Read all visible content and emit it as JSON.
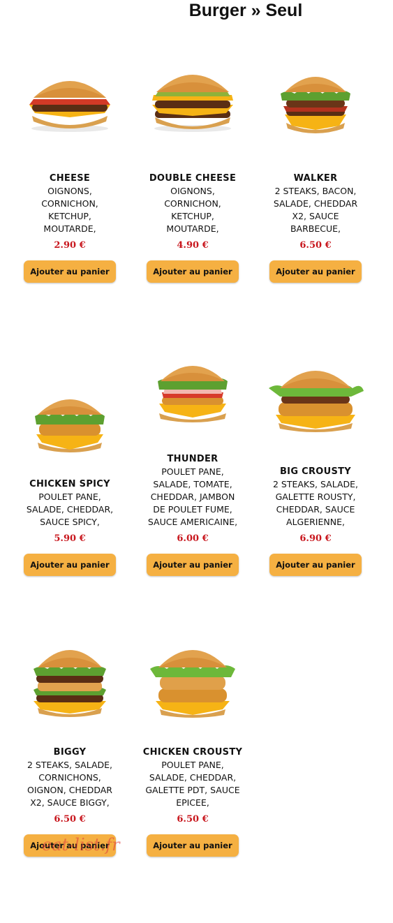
{
  "header": {
    "title": "Burger » Seul"
  },
  "watermark": "eat-list.fr",
  "colors": {
    "button": "#f5b042",
    "price": "#c8161d"
  },
  "products": [
    {
      "name": "CHEESE",
      "desc": [
        "OIGNONS,",
        "CORNICHON,",
        "KETCHUP,",
        "MOUTARDE,"
      ],
      "price": "2.90 €",
      "button": "Ajouter au panier",
      "icon": "cheeseburger-icon"
    },
    {
      "name": "DOUBLE CHEESE",
      "desc": [
        "OIGNONS,",
        "CORNICHON,",
        "KETCHUP,",
        "MOUTARDE,"
      ],
      "price": "4.90 €",
      "button": "Ajouter au panier",
      "icon": "double-cheeseburger-icon"
    },
    {
      "name": "WALKER",
      "desc": [
        "2 STEAKS, BACON,",
        "SALADE, CHEDDAR",
        "X2, SAUCE",
        "BARBECUE,"
      ],
      "price": "6.50 €",
      "button": "Ajouter au panier",
      "icon": "walker-burger-icon"
    },
    {
      "name": "CHICKEN SPICY",
      "desc": [
        "POULET PANE,",
        "SALADE, CHEDDAR,",
        "SAUCE SPICY,"
      ],
      "price": "5.90 €",
      "button": "Ajouter au panier",
      "icon": "chicken-spicy-burger-icon"
    },
    {
      "name": "THUNDER",
      "desc": [
        "POULET PANE,",
        "SALADE, TOMATE,",
        "CHEDDAR, JAMBON",
        "DE POULET FUME,",
        "SAUCE AMERICAINE,"
      ],
      "price": "6.00 €",
      "button": "Ajouter au panier",
      "icon": "thunder-burger-icon"
    },
    {
      "name": "BIG CROUSTY",
      "desc": [
        "2 STEAKS, SALADE,",
        "GALETTE ROUSTY,",
        "CHEDDAR, SAUCE",
        "ALGERIENNE,"
      ],
      "price": "6.90 €",
      "button": "Ajouter au panier",
      "icon": "big-crousty-burger-icon"
    },
    {
      "name": "BIGGY",
      "desc": [
        "2 STEAKS, SALADE,",
        "CORNICHONS,",
        "OIGNON, CHEDDAR",
        "X2, SAUCE BIGGY,"
      ],
      "price": "6.50 €",
      "button": "Ajouter au panier",
      "icon": "biggy-burger-icon"
    },
    {
      "name": "CHICKEN CROUSTY",
      "desc": [
        "POULET PANE,",
        "SALADE, CHEDDAR,",
        "GALETTE PDT, SAUCE",
        "EPICEE,"
      ],
      "price": "6.50 €",
      "button": "Ajouter au panier",
      "icon": "chicken-crousty-burger-icon"
    }
  ]
}
